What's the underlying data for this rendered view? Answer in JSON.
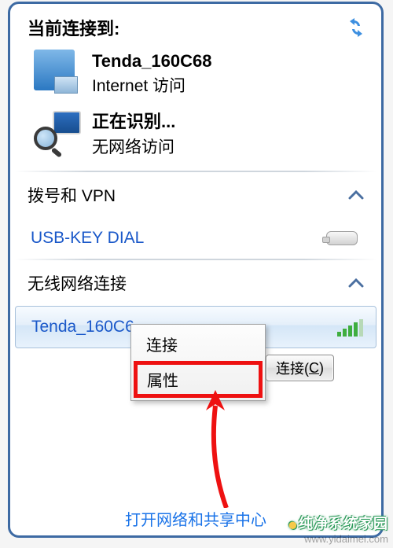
{
  "header": {
    "label": "当前连接到:"
  },
  "connections": {
    "wired": {
      "name": "Tenda_160C68",
      "status": "Internet 访问"
    },
    "identifying": {
      "name": "正在识别...",
      "status": "无网络访问"
    }
  },
  "sections": {
    "dial_vpn": {
      "label": "拨号和 VPN",
      "item": "USB-KEY DIAL"
    },
    "wireless": {
      "label": "无线网络连接",
      "selected": "Tenda_160C6"
    }
  },
  "context_menu": {
    "connect": "连接",
    "properties": "属性"
  },
  "connect_button": {
    "prefix": "连接(",
    "key": "C",
    "suffix": ")"
  },
  "footer": {
    "link": "打开网络和共享中心"
  },
  "watermark": {
    "brand": "纯净系统家园",
    "url": "www.yidaimei.com"
  }
}
